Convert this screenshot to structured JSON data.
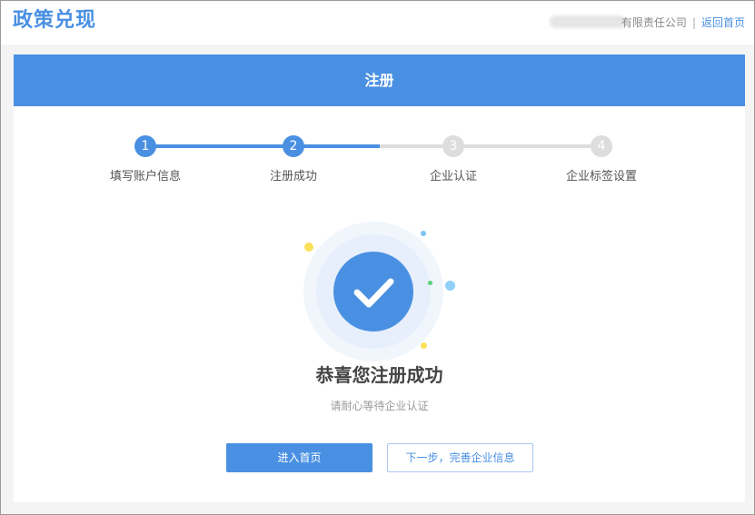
{
  "header": {
    "logo": "政策兑现",
    "company_suffix": "有限责任公司",
    "separator": "|",
    "home_link": "返回首页"
  },
  "banner": {
    "title": "注册"
  },
  "steps": [
    {
      "number": "1",
      "label": "填写账户信息",
      "state": "done"
    },
    {
      "number": "2",
      "label": "注册成功",
      "state": "done"
    },
    {
      "number": "3",
      "label": "企业认证",
      "state": "todo"
    },
    {
      "number": "4",
      "label": "企业标签设置",
      "state": "todo"
    }
  ],
  "result": {
    "title": "恭喜您注册成功",
    "subtitle": "请耐心等待企业认证"
  },
  "actions": {
    "primary_label": "进入首页",
    "secondary_label": "下一步，完善企业信息"
  },
  "colors": {
    "accent": "#4a90e2",
    "inactive": "#dddddd",
    "page_bg": "#f4f4f4"
  },
  "icons": {
    "success": "check-icon"
  }
}
